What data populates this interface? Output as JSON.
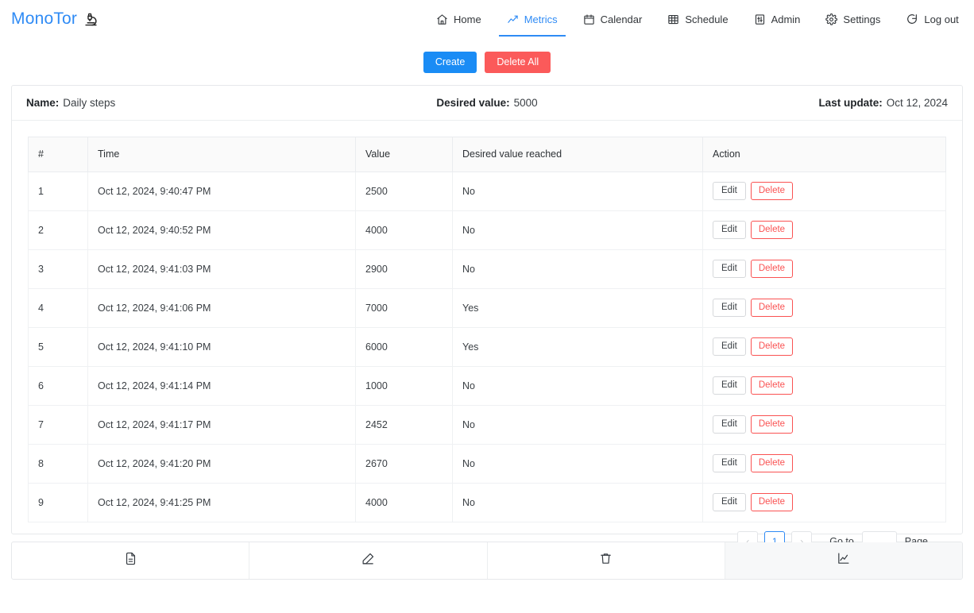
{
  "brand": {
    "name": "MonoTor",
    "icon": "microscope-icon",
    "color": "#2f8bf5"
  },
  "nav": {
    "items": [
      {
        "label": "Home",
        "icon": "home-icon",
        "active": false
      },
      {
        "label": "Metrics",
        "icon": "chart-line-icon",
        "active": true
      },
      {
        "label": "Calendar",
        "icon": "calendar-icon",
        "active": false
      },
      {
        "label": "Schedule",
        "icon": "grid-table-icon",
        "active": false
      },
      {
        "label": "Admin",
        "icon": "sliders-icon",
        "active": false
      },
      {
        "label": "Settings",
        "icon": "gear-icon",
        "active": false
      },
      {
        "label": "Log out",
        "icon": "logout-icon",
        "active": false
      }
    ]
  },
  "actions": {
    "create_label": "Create",
    "delete_all_label": "Delete All",
    "create_color": "#1a8cf5",
    "delete_all_color": "#fb5a5a"
  },
  "info": {
    "name_label": "Name:",
    "name_value": "Daily steps",
    "desired_label": "Desired value:",
    "desired_value": "5000",
    "update_label": "Last update:",
    "update_value": "Oct 12, 2024"
  },
  "table": {
    "headers": [
      "#",
      "Time",
      "Value",
      "Desired value reached",
      "Action"
    ],
    "edit_label": "Edit",
    "delete_label": "Delete",
    "rows": [
      {
        "num": "1",
        "time": "Oct 12, 2024, 9:40:47 PM",
        "value": "2500",
        "reached": "No"
      },
      {
        "num": "2",
        "time": "Oct 12, 2024, 9:40:52 PM",
        "value": "4000",
        "reached": "No"
      },
      {
        "num": "3",
        "time": "Oct 12, 2024, 9:41:03 PM",
        "value": "2900",
        "reached": "No"
      },
      {
        "num": "4",
        "time": "Oct 12, 2024, 9:41:06 PM",
        "value": "7000",
        "reached": "Yes"
      },
      {
        "num": "5",
        "time": "Oct 12, 2024, 9:41:10 PM",
        "value": "6000",
        "reached": "Yes"
      },
      {
        "num": "6",
        "time": "Oct 12, 2024, 9:41:14 PM",
        "value": "1000",
        "reached": "No"
      },
      {
        "num": "7",
        "time": "Oct 12, 2024, 9:41:17 PM",
        "value": "2452",
        "reached": "No"
      },
      {
        "num": "8",
        "time": "Oct 12, 2024, 9:41:20 PM",
        "value": "2670",
        "reached": "No"
      },
      {
        "num": "9",
        "time": "Oct 12, 2024, 9:41:25 PM",
        "value": "4000",
        "reached": "No"
      }
    ]
  },
  "pagination": {
    "prev": "‹",
    "next": "›",
    "current_page": "1",
    "goto_label": "Go to",
    "goto_value": "",
    "goto_placeholder": "",
    "page_label": "Page"
  },
  "footer": {
    "items": [
      {
        "icon": "document-icon",
        "active": false
      },
      {
        "icon": "pencil-icon",
        "active": false
      },
      {
        "icon": "trash-icon",
        "active": false
      },
      {
        "icon": "chart-icon",
        "active": true
      }
    ]
  }
}
